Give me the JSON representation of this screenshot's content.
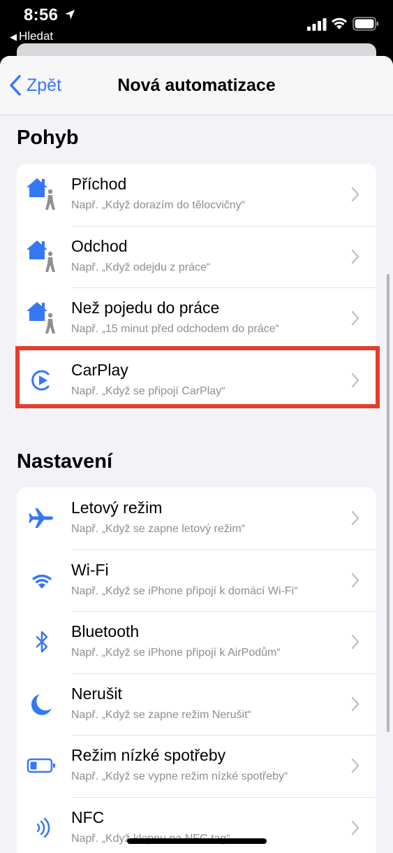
{
  "status_bar": {
    "time": "8:56",
    "back_app": "Hledat"
  },
  "nav": {
    "back_label": "Zpět",
    "title": "Nová automatizace"
  },
  "sections": [
    {
      "title": "Pohyb",
      "items": [
        {
          "title": "Příchod",
          "subtitle": "Např. „Když dorazím do tělocvičny“",
          "icon": "arrive-icon"
        },
        {
          "title": "Odchod",
          "subtitle": "Např. „Když odejdu z práce“",
          "icon": "leave-icon"
        },
        {
          "title": "Než pojedu do práce",
          "subtitle": "Např. „15 minut před odchodem do práce“",
          "icon": "commute-icon"
        },
        {
          "title": "CarPlay",
          "subtitle": "Např. „Když se připojí CarPlay“",
          "icon": "carplay-icon"
        }
      ]
    },
    {
      "title": "Nastavení",
      "items": [
        {
          "title": "Letový režim",
          "subtitle": "Např. „Když se zapne letový režim“",
          "icon": "airplane-icon"
        },
        {
          "title": "Wi-Fi",
          "subtitle": "Např. „Když se iPhone připojí k domácí Wi-Fi“",
          "icon": "wifi-icon"
        },
        {
          "title": "Bluetooth",
          "subtitle": "Např. „Když se iPhone připojí k AirPodům“",
          "icon": "bluetooth-icon"
        },
        {
          "title": "Nerušit",
          "subtitle": "Např. „Když se zapne režim Nerušit“",
          "icon": "moon-icon"
        },
        {
          "title": "Režim nízké spotřeby",
          "subtitle": "Např. „Když se vypne režim nízké spotřeby“",
          "icon": "battery-low-icon"
        },
        {
          "title": "NFC",
          "subtitle": "Např. „Když klepnu na NFC tag“",
          "icon": "nfc-icon"
        }
      ]
    }
  ],
  "colors": {
    "accent": "#3478f6",
    "highlight": "#e63d2c",
    "background": "#f2f2f7"
  }
}
